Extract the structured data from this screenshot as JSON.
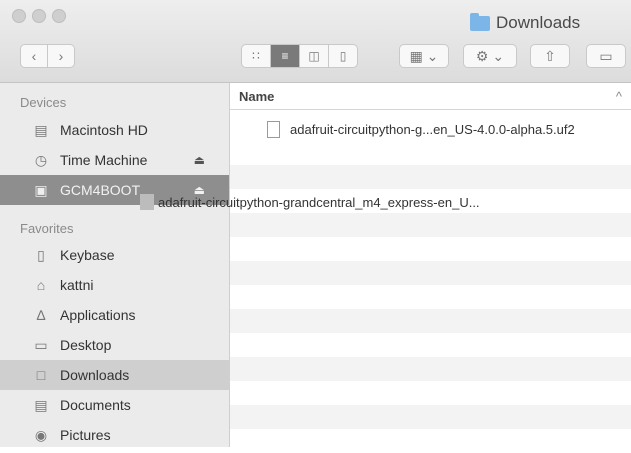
{
  "window": {
    "title": "Downloads"
  },
  "toolbar": {
    "back_icon": "chevron-left",
    "forward_icon": "chevron-right",
    "view_icons": [
      "icon-view",
      "list-view",
      "column-view",
      "cover-flow-view"
    ],
    "arrange_icon": "grid-arrange",
    "action_icon": "gear",
    "share_icon": "share",
    "tag_icon": "tag"
  },
  "sidebar": {
    "devices_label": "Devices",
    "devices": [
      {
        "label": "Macintosh HD",
        "icon": "disk-icon"
      },
      {
        "label": "Time Machine",
        "icon": "time-machine-icon",
        "eject": true
      },
      {
        "label": "GCM4BOOT",
        "icon": "usb-drive-icon",
        "eject": true
      }
    ],
    "favorites_label": "Favorites",
    "favorites": [
      {
        "label": "Keybase",
        "icon": "document-icon"
      },
      {
        "label": "kattni",
        "icon": "home-icon"
      },
      {
        "label": "Applications",
        "icon": "applications-icon"
      },
      {
        "label": "Desktop",
        "icon": "desktop-icon"
      },
      {
        "label": "Downloads",
        "icon": "downloads-icon"
      },
      {
        "label": "Documents",
        "icon": "documents-icon"
      },
      {
        "label": "Pictures",
        "icon": "camera-icon"
      }
    ]
  },
  "main": {
    "column_name": "Name",
    "sort_indicator": "^",
    "file": "adafruit-circuitpython-g...en_US-4.0.0-alpha.5.uf2"
  },
  "drag": {
    "label": "adafruit-circuitpython-grandcentral_m4_express-en_U..."
  },
  "eject_symbol": "⏏"
}
